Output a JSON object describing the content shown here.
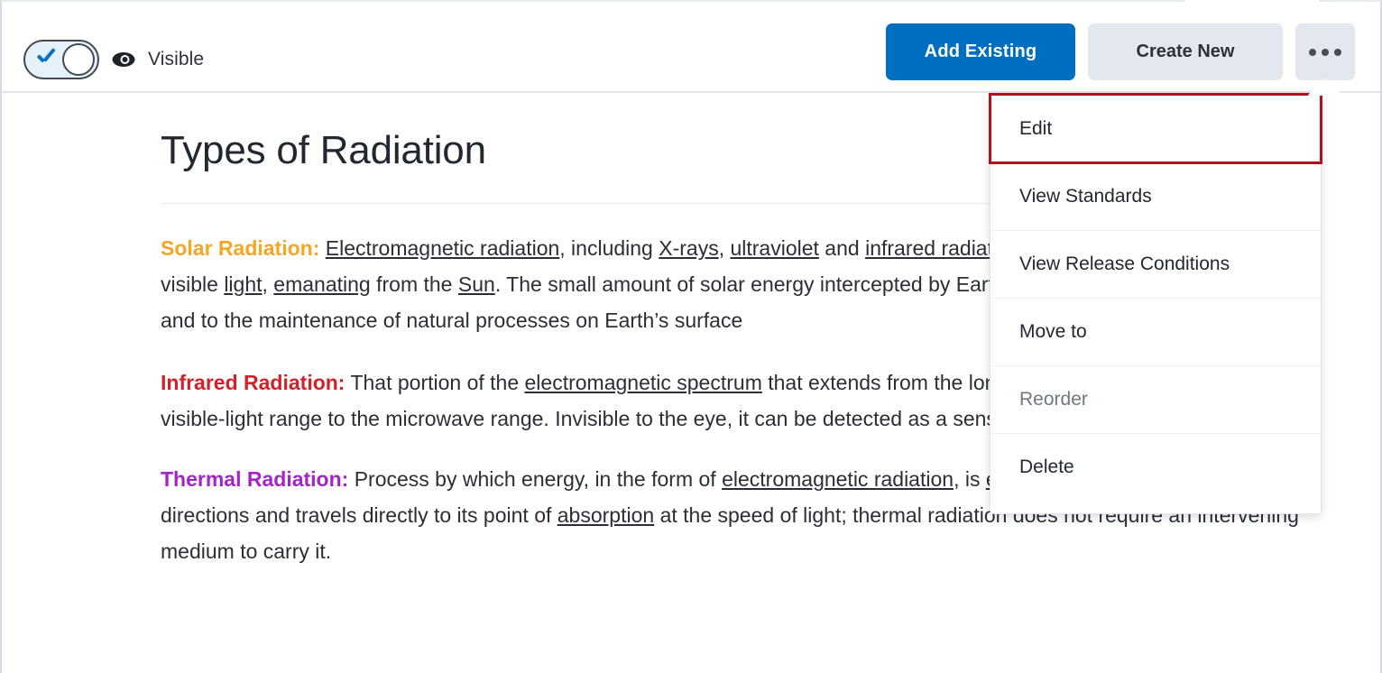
{
  "toolbar": {
    "toggle": {
      "state": "on",
      "name": "visibility-toggle"
    },
    "visibility_label": "Visible",
    "eye_icon": "eye-icon",
    "buttons": {
      "add_existing": "Add Existing",
      "create_new": "Create New",
      "overflow": "..."
    },
    "top_select": {
      "chevron_icon": "chevron-down-icon"
    }
  },
  "menu": {
    "items": [
      {
        "label": "Edit",
        "state": "highlighted"
      },
      {
        "label": "View Standards",
        "state": "normal"
      },
      {
        "label": "View Release Conditions",
        "state": "normal"
      },
      {
        "label": "Move to",
        "state": "normal"
      },
      {
        "label": "Reorder",
        "state": "disabled"
      },
      {
        "label": "Delete",
        "state": "normal"
      }
    ]
  },
  "document": {
    "title": "Types of Radiation",
    "paragraphs": [
      {
        "term": "Solar Radiation:",
        "term_color": "#f5a623",
        "segments": [
          {
            "text": " ",
            "underline": false
          },
          {
            "text": "Electromagnetic radiation",
            "underline": true
          },
          {
            "text": ", including ",
            "underline": false
          },
          {
            "text": "X-rays",
            "underline": true
          },
          {
            "text": ", ",
            "underline": false
          },
          {
            "text": "ultraviolet",
            "underline": true
          },
          {
            "text": " and ",
            "underline": false
          },
          {
            "text": "infrared radiation",
            "underline": true
          },
          {
            "text": " and radio emissions, as well as visible ",
            "underline": false
          },
          {
            "text": "light",
            "underline": true
          },
          {
            "text": ", ",
            "underline": false
          },
          {
            "text": "emanating",
            "underline": true
          },
          {
            "text": " from the ",
            "underline": false
          },
          {
            "text": "Sun",
            "underline": true
          },
          {
            "text": ". The small amount of solar energy intercepted by Earth is of enormous importance to life and to the maintenance of natural processes on Earth’s surface",
            "underline": false
          }
        ]
      },
      {
        "term": "Infrared Radiation:",
        "term_color": "#d32029",
        "segments": [
          {
            "text": " That portion of the ",
            "underline": false
          },
          {
            "text": "electromagnetic spectrum",
            "underline": true
          },
          {
            "text": " that extends from the long wavelength, or red, end of the visible-light range to the microwave range. Invisible to the eye, it can be detected as a sensation of warmth on the skin.",
            "underline": false
          }
        ]
      },
      {
        "term": "Thermal Radiation:",
        "term_color": "#a324c9",
        "segments": [
          {
            "text": " Process by which energy, in the form of ",
            "underline": false
          },
          {
            "text": "electromagnetic radiation",
            "underline": true
          },
          {
            "text": ", is ",
            "underline": false
          },
          {
            "text": "emitted",
            "underline": true
          },
          {
            "text": " by a heated surface in all directions and travels directly to its point of ",
            "underline": false
          },
          {
            "text": "absorption",
            "underline": true
          },
          {
            "text": " at the speed of light; thermal radiation does not require an intervening medium to carry it.",
            "underline": false
          }
        ]
      }
    ]
  },
  "colors": {
    "primary_button": "#006fbf",
    "secondary_button": "#e3e8ee",
    "highlight_outline": "#b0121f",
    "toggle_on": "#e5f2fb",
    "check_blue": "#0a72c4"
  }
}
